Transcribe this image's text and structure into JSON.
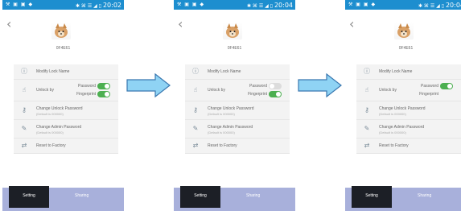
{
  "status": {
    "left_icons": "⚒ ▣ ▣ ◆",
    "right_icons": "✱ ⌘ ☰ ◢ ▯"
  },
  "screens": [
    {
      "time": "20:02",
      "lock_id": "0F4E61",
      "modify_label": "Modify Lock Name",
      "unlock_label": "Unlock by",
      "password_label": "Password",
      "fingerprint_label": "Fingerprint",
      "password_on": true,
      "fingerprint_on": true,
      "change_unlock_label": "Change Unlock Password",
      "change_unlock_sub": "(Default is 000000)",
      "change_admin_label": "Change Admin Password",
      "change_admin_sub": "(Default is 000000)",
      "reset_label": "Reset to Factory",
      "tab_setting": "Setting",
      "tab_sharing": "Sharing"
    },
    {
      "time": "20:04",
      "lock_id": "0F4E61",
      "modify_label": "Modify Lock Name",
      "unlock_label": "Unlock by",
      "password_label": "Password",
      "fingerprint_label": "Fingerprint",
      "password_on": false,
      "fingerprint_on": true,
      "change_unlock_label": "Change Unlock Password",
      "change_unlock_sub": "(Default is 000000)",
      "change_admin_label": "Change Admin Password",
      "change_admin_sub": "(Default is 000000)",
      "reset_label": "Reset to Factory",
      "tab_setting": "Setting",
      "tab_sharing": "Sharing"
    },
    {
      "time": "20:04",
      "lock_id": "0F4E61",
      "modify_label": "Modify Lock Name",
      "unlock_label": "Unlock by",
      "password_label": "Password",
      "fingerprint_label": "Fingerprint",
      "password_on": true,
      "fingerprint_on": false,
      "change_unlock_label": "Change Unlock Password",
      "change_unlock_sub": "(Default is 000000)",
      "change_admin_label": "Change Admin Password",
      "change_admin_sub": "(Default is 000000)",
      "reset_label": "Reset to Factory",
      "tab_setting": "Setting",
      "tab_sharing": "Sharing"
    }
  ],
  "icons": {
    "back": "chevron-left-icon",
    "modify": "info-circle-icon",
    "unlock": "fingerprint-icon",
    "change_unlock": "key-icon",
    "change_admin": "pen-icon",
    "reset": "reset-icon",
    "arrow": "arrow-right-icon"
  },
  "colors": {
    "status_bar": "#1d8ecf",
    "toggle_on": "#4caf50",
    "toggle_off": "#dcdcdc",
    "tab_bar": "#a8b0db",
    "tab_active": "#1c1f26",
    "arrow_fill": "#8fd3f4",
    "arrow_stroke": "#3a78b0"
  }
}
